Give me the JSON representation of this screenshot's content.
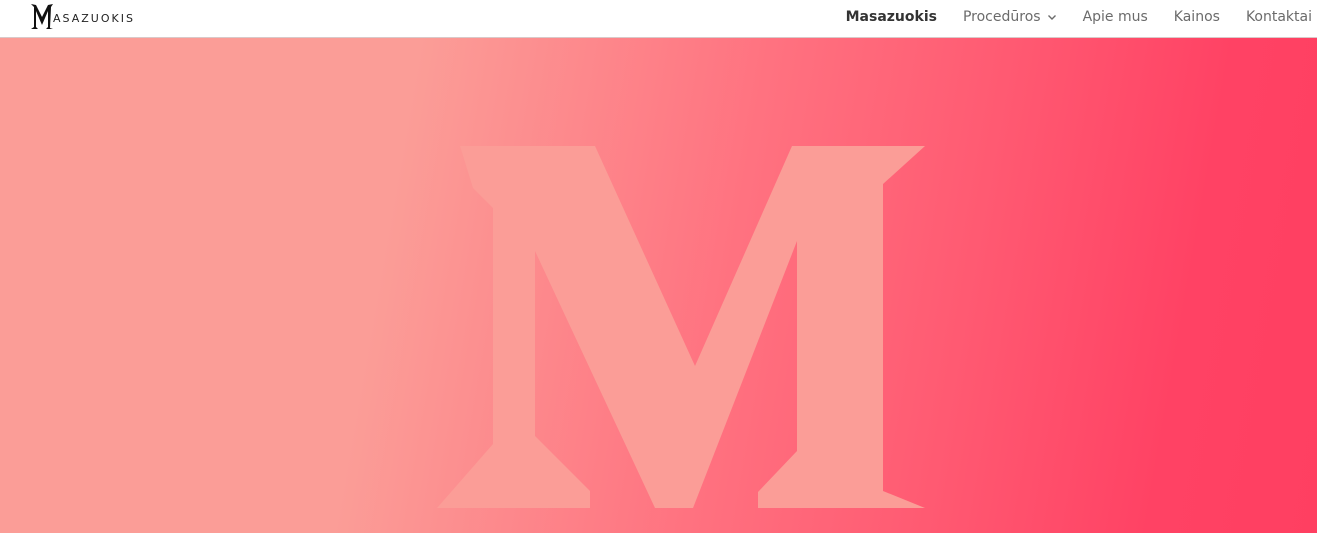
{
  "brand": {
    "logo_text": "ASAZUOKIS",
    "logo_icon": "m-logo-icon"
  },
  "nav": {
    "items": [
      {
        "label": "Masazuokis",
        "active": true
      },
      {
        "label": "Procedūros",
        "has_dropdown": true
      },
      {
        "label": "Apie mus"
      },
      {
        "label": "Kainos"
      },
      {
        "label": "Kontaktai"
      }
    ],
    "dropdown_icon": "chevron-down-icon"
  },
  "hero": {
    "mark_icon": "large-m-letter",
    "colors": {
      "gradient_start": "#fb9d97",
      "gradient_end": "#ff3f61",
      "mark_color": "#fb9d97"
    }
  }
}
